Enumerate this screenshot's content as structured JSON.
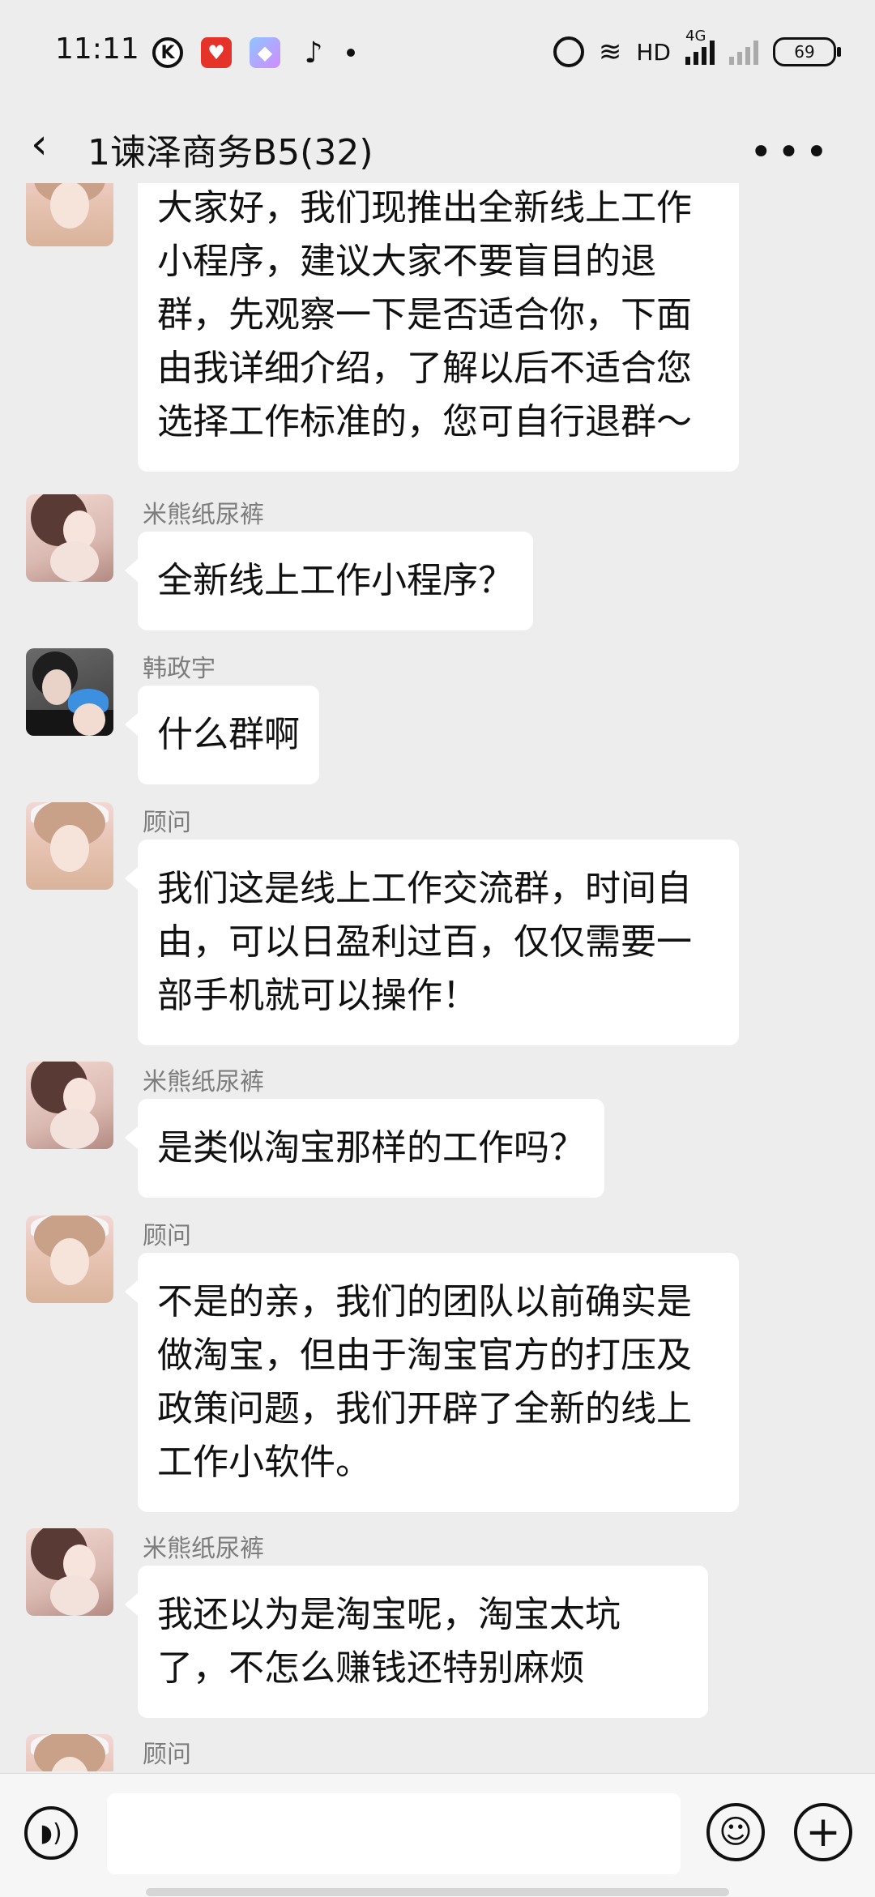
{
  "status_bar": {
    "time": "11:11",
    "network_label": "HD",
    "signal_label": "4G",
    "battery": "69"
  },
  "header": {
    "title": "1谏泽商务B5(32)",
    "back_icon": "chevron-left-icon",
    "more_icon": "more-horizontal-icon"
  },
  "messages": [
    {
      "sender": "",
      "avatar": "avatar-girl",
      "text": "大家好，我们现推出全新线上工作小程序，建议大家不要盲目的退群，先观察一下是否适合你，下面由我详细介绍，了解以后不适合您选择工作标准的，您可自行退群～"
    },
    {
      "sender": "米熊纸尿裤",
      "avatar": "avatar-mom",
      "text": "全新线上工作小程序？"
    },
    {
      "sender": "韩政宇",
      "avatar": "avatar-couple",
      "text": "什么群啊"
    },
    {
      "sender": "顾问",
      "avatar": "avatar-girl",
      "text": "我们这是线上工作交流群，时间自由，可以日盈利过百，仅仅需要一部手机就可以操作！"
    },
    {
      "sender": "米熊纸尿裤",
      "avatar": "avatar-mom",
      "text": "是类似淘宝那样的工作吗？"
    },
    {
      "sender": "顾问",
      "avatar": "avatar-girl",
      "text": "不是的亲，我们的团队以前确实是做淘宝，但由于淘宝官方的打压及政策问题，我们开辟了全新的线上工作小软件。"
    },
    {
      "sender": "米熊纸尿裤",
      "avatar": "avatar-mom",
      "text": "我还以为是淘宝呢，淘宝太坑了，不怎么赚钱还特别麻烦"
    },
    {
      "sender": "顾问",
      "avatar": "avatar-girl",
      "text": ""
    }
  ],
  "input_bar": {
    "voice_icon": "voice-icon",
    "input_value": "",
    "emoji_icon": "emoji-icon",
    "plus_icon": "plus-icon"
  }
}
